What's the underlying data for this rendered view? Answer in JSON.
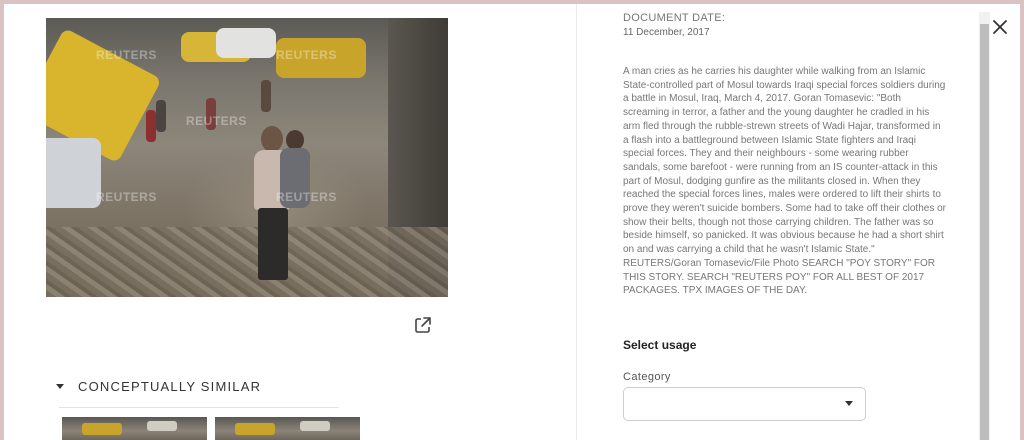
{
  "photo": {
    "alt": "Man carrying his daughter in Mosul",
    "watermark": "REUTERS"
  },
  "actions": {
    "open_external_icon": "external-link-icon"
  },
  "similar": {
    "toggle_icon": "caret-down-icon",
    "title": "CONCEPTUALLY SIMILAR"
  },
  "document": {
    "date_label": "DOCUMENT DATE:",
    "date": "11 December, 2017",
    "description": "A man cries as he carries his daughter while walking from an Islamic State-controlled part of Mosul towards Iraqi special forces soldiers during a battle in Mosul, Iraq, March 4, 2017. Goran Tomasevic: \"Both screaming in terror, a father and the young daughter he cradled in his arm fled through the rubble-strewn streets of Wadi Hajar, transformed in a flash into a battleground between Islamic State fighters and Iraqi special forces. They and their neighbours - some wearing rubber sandals, some barefoot - were running from an IS counter-attack in this part of Mosul, dodging gunfire as the militants closed in. When they reached the special forces lines, males were ordered to lift their shirts to prove they weren't suicide bombers. Some had to take off their clothes or show their belts, though not those carrying children. The father was so beside himself, so panicked. It was obvious because he had a short shirt on and was carrying a child that he wasn't Islamic State.\" REUTERS/Goran Tomasevic/File Photo SEARCH \"POY STORY\" FOR THIS STORY. SEARCH \"REUTERS POY\" FOR ALL BEST OF 2017 PACKAGES. TPX IMAGES OF THE DAY."
  },
  "usage": {
    "title": "Select usage",
    "category_label": "Category",
    "category_value": "",
    "category_caret_icon": "caret-down-icon"
  },
  "close_icon": "close-icon"
}
